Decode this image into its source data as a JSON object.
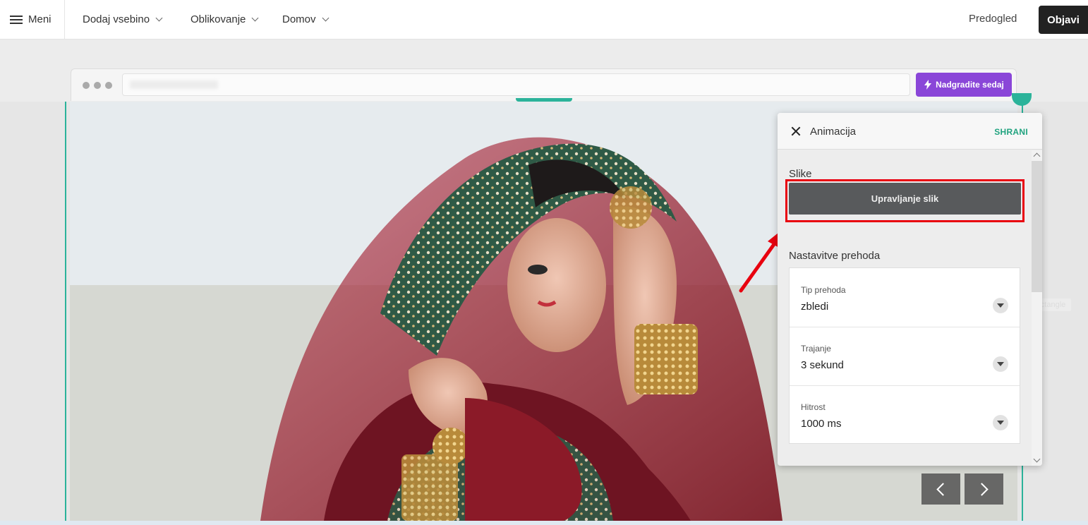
{
  "topbar": {
    "menu_label": "Meni",
    "nav": [
      {
        "label": "Dodaj vsebino"
      },
      {
        "label": "Oblikovanje"
      },
      {
        "label": "Domov"
      }
    ],
    "preview_label": "Predogled",
    "publish_label": "Objavi"
  },
  "browser": {
    "upgrade_label": "Nadgradite sedaj",
    "upgrade_color": "#8a46d8"
  },
  "hero": {
    "prev_icon": "chevron-left-icon",
    "next_icon": "chevron-right-icon",
    "rect_tag": "Rectangle"
  },
  "panel": {
    "title": "Animacija",
    "save_label": "SHRANI",
    "images_section": "Slike",
    "manage_images_label": "Upravljanje slik",
    "transition_section": "Nastavitve prehoda",
    "fields": [
      {
        "label": "Tip prehoda",
        "value": "zbledi"
      },
      {
        "label": "Trajanje",
        "value": "3 sekund"
      },
      {
        "label": "Hitrost",
        "value": "1000 ms"
      }
    ]
  },
  "colors": {
    "accent_green": "#2bb39a",
    "save_green": "#20a37f",
    "highlight_red": "#e8000f"
  }
}
